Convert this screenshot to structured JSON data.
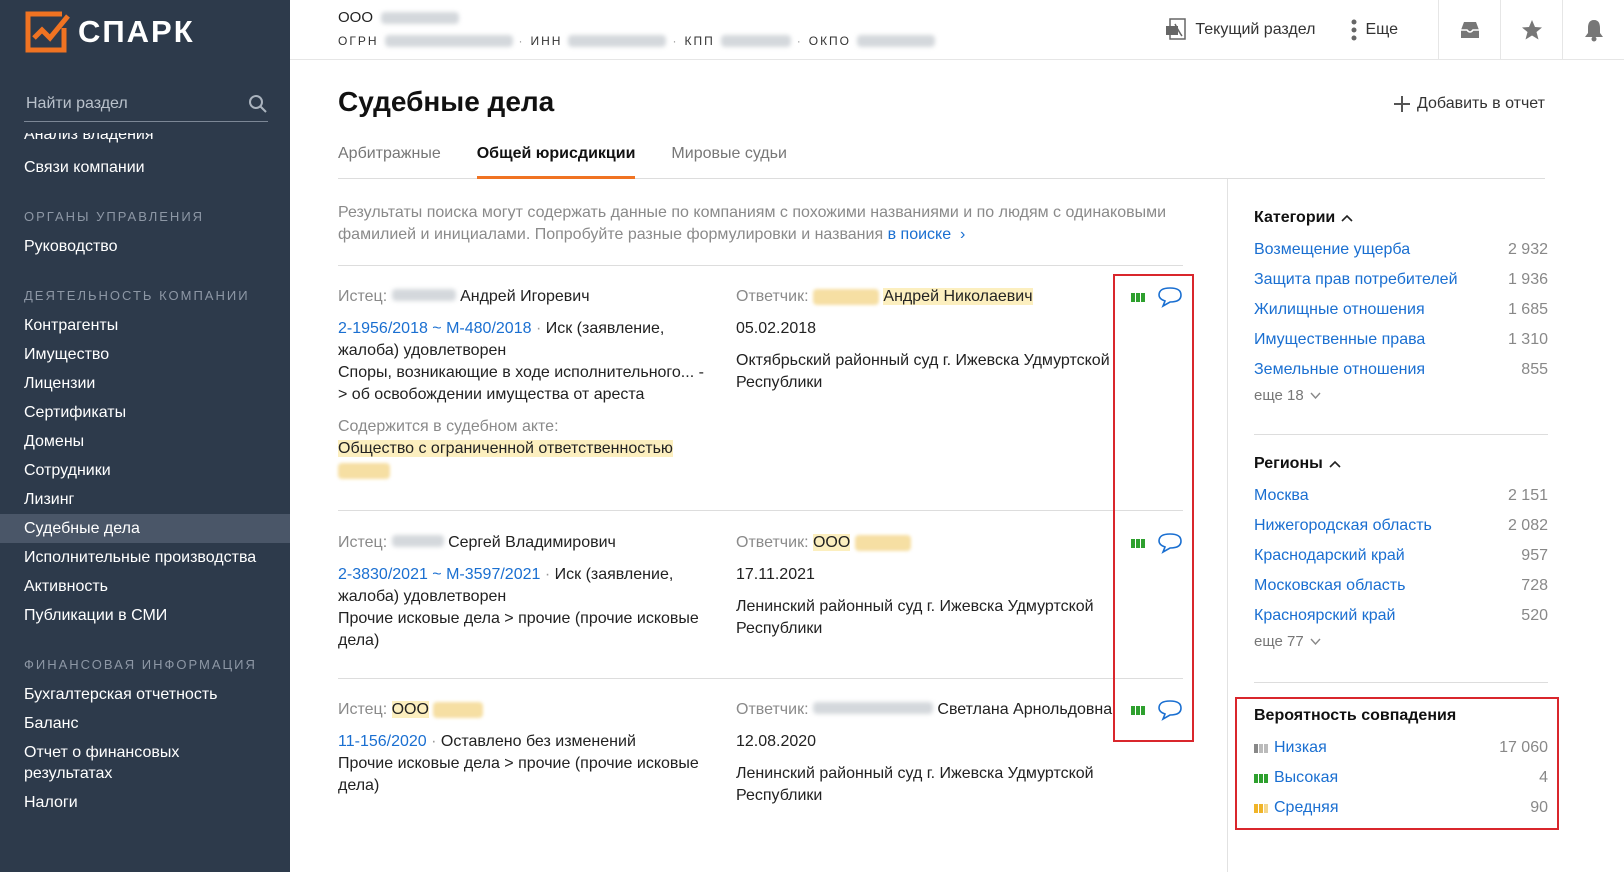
{
  "app": {
    "logo_text": "СПАРК",
    "accent": "#f07322",
    "sidebar_bg": "#2d3a4b"
  },
  "sidebar": {
    "search_placeholder": "Найти раздел",
    "clipped_item": "Анализ владения",
    "items_top": [
      "Связи компании"
    ],
    "section_governance": "ОРГАНЫ УПРАВЛЕНИЯ",
    "items_governance": [
      "Руководство"
    ],
    "section_activity": "ДЕЯТЕЛЬНОСТЬ КОМПАНИИ",
    "items_activity": [
      "Контрагенты",
      "Имущество",
      "Лицензии",
      "Сертификаты",
      "Домены",
      "Сотрудники",
      "Лизинг",
      "Судебные дела",
      "Исполнительные производства",
      "Активность",
      "Публикации в СМИ"
    ],
    "section_finance": "ФИНАНСОВАЯ ИНФОРМАЦИЯ",
    "items_finance": [
      "Бухгалтерская отчетность",
      "Баланс",
      "Отчет о финансовых результатах",
      "Налоги"
    ]
  },
  "header": {
    "company_prefix": "ООО",
    "ogrn_label": "ОГРН",
    "inn_label": "ИНН",
    "kpp_label": "КПП",
    "okpo_label": "ОКПО",
    "current_section": "Текущий раздел",
    "more": "Еще"
  },
  "main": {
    "title": "Судебные дела",
    "add_to_report": "Добавить в отчет",
    "tabs": [
      "Арбитражные",
      "Общей юрисдикции",
      "Мировые судьи"
    ],
    "notice_text": "Результаты поиска могут содержать данные по компаниям с похожими названиями и по людям с одинаковыми фамилией и инициалами. Попробуйте разные формулировки и названия",
    "notice_link": "в поиске"
  },
  "cases": [
    {
      "plaintiff_label": "Истец:",
      "plaintiff_name": "Андрей Игоревич",
      "case_link": "2-1956/2018 ~ М-480/2018",
      "result": "Иск (заявление, жалоба) удовлетворен",
      "category": "Споры, возникающие в ходе исполнительного... -> об освобождении имущества от ареста",
      "act_label": "Содержится в судебном акте:",
      "act_text": "Общество с ограниченной ответственностью",
      "defendant_label": "Ответчик:",
      "defendant_name": "Андрей Николаевич",
      "date": "05.02.2018",
      "court": "Октябрьский районный суд г. Ижевска Удмуртской Республики"
    },
    {
      "plaintiff_label": "Истец:",
      "plaintiff_name": "Сергей Владимирович",
      "case_link": "2-3830/2021 ~ М-3597/2021",
      "result": "Иск (заявление, жалоба) удовлетворен",
      "category": "Прочие исковые дела > прочие (прочие исковые дела)",
      "defendant_label": "Ответчик:",
      "defendant_name": "ООО",
      "date": "17.11.2021",
      "court": "Ленинский районный суд г. Ижевска Удмуртской Республики"
    },
    {
      "plaintiff_label": "Истец:",
      "plaintiff_name": "ООО",
      "case_link": "11-156/2020",
      "result": "Оставлено без изменений",
      "category": "Прочие исковые дела > прочие (прочие исковые дела)",
      "defendant_label": "Ответчик:",
      "defendant_name": "Светлана Арнольдовна",
      "date": "12.08.2020",
      "court": "Ленинский районный суд г. Ижевска Удмуртской Республики"
    }
  ],
  "facets": {
    "categories": {
      "title": "Категории",
      "items": [
        {
          "name": "Возмещение ущерба",
          "count": "2 932"
        },
        {
          "name": "Защита прав потребителей",
          "count": "1 936"
        },
        {
          "name": "Жилищные отношения",
          "count": "1 685"
        },
        {
          "name": "Имущественные права",
          "count": "1 310"
        },
        {
          "name": "Земельные отношения",
          "count": "855"
        }
      ],
      "more": "еще 18"
    },
    "regions": {
      "title": "Регионы",
      "items": [
        {
          "name": "Москва",
          "count": "2 151"
        },
        {
          "name": "Нижегородская область",
          "count": "2 082"
        },
        {
          "name": "Краснодарский край",
          "count": "957"
        },
        {
          "name": "Московская область",
          "count": "728"
        },
        {
          "name": "Красноярский край",
          "count": "520"
        }
      ],
      "more": "еще 77"
    },
    "probability": {
      "title": "Вероятность совпадения",
      "items": [
        {
          "name": "Низкая",
          "count": "17 060",
          "level": "low"
        },
        {
          "name": "Высокая",
          "count": "4",
          "level": "high"
        },
        {
          "name": "Средняя",
          "count": "90",
          "level": "medium"
        }
      ]
    }
  }
}
